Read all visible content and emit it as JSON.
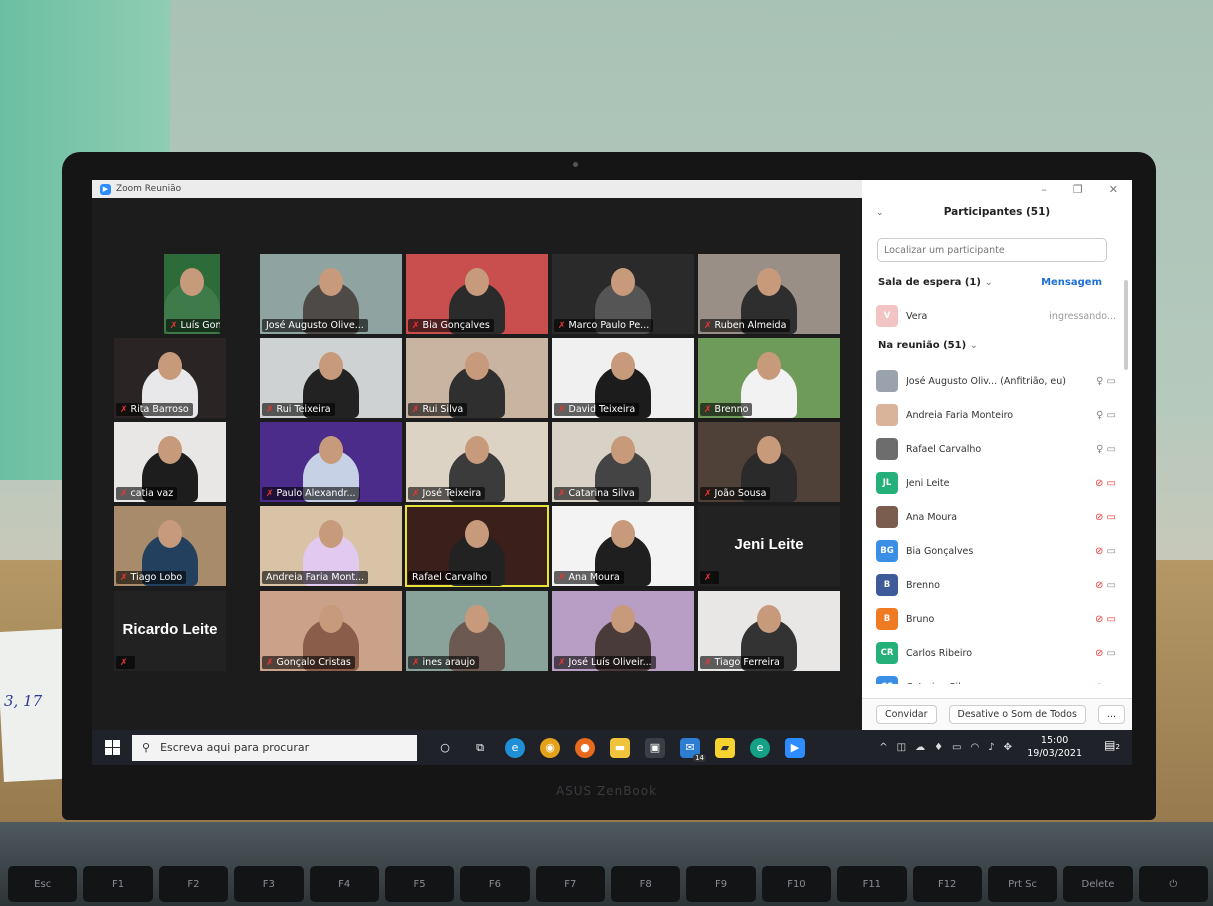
{
  "window": {
    "title": "Zoom Reunião",
    "controls": [
      "–",
      "❐",
      "✕"
    ]
  },
  "gallery": {
    "tiles": [
      {
        "name": "Luís Gonçalves",
        "muted": true
      },
      {
        "name": "José Augusto Olive...",
        "muted": false
      },
      {
        "name": "Bia Gonçalves",
        "muted": true
      },
      {
        "name": "Marco Paulo Pe...",
        "muted": true
      },
      {
        "name": "Ruben Almeida",
        "muted": true
      },
      {
        "name": "Rita Barroso",
        "muted": true
      },
      {
        "name": "Rui Teixeira",
        "muted": true
      },
      {
        "name": "Rui Silva",
        "muted": true
      },
      {
        "name": "David Teixeira",
        "muted": true
      },
      {
        "name": "Brenno",
        "muted": true
      },
      {
        "name": "catia vaz",
        "muted": true
      },
      {
        "name": "Paulo Alexandr...",
        "muted": true
      },
      {
        "name": "José Teixeira",
        "muted": true
      },
      {
        "name": "Catarina Silva",
        "muted": true
      },
      {
        "name": "João Sousa",
        "muted": true
      },
      {
        "name": "Tiago Lobo",
        "muted": true
      },
      {
        "name": "Andreia Faria Mont...",
        "muted": false
      },
      {
        "name": "Rafael Carvalho",
        "muted": false
      },
      {
        "name": "Ana Moura",
        "muted": true
      },
      {
        "name": "",
        "muted": true,
        "big_name": "Jeni Leite"
      },
      {
        "name": "",
        "muted": true,
        "big_name": "Ricardo Leite"
      },
      {
        "name": "Gonçalo Cristas",
        "muted": true
      },
      {
        "name": "ines araujo",
        "muted": true
      },
      {
        "name": "José Luís Oliveir...",
        "muted": true
      },
      {
        "name": "Tiago Ferreira",
        "muted": true
      }
    ]
  },
  "participants": {
    "title": "Participantes (51)",
    "search_placeholder": "Localizar um participante",
    "waiting_room_label": "Sala de espera (1)",
    "message_button": "Mensagem",
    "waiting": {
      "name": "Vera",
      "initial": "V",
      "status": "ingressando..."
    },
    "in_meeting_label": "Na reunião (51)",
    "list": [
      {
        "name": "José Augusto Oliv... (Anfitrião, eu)",
        "initials": "",
        "color": "#9aa3ad",
        "mic": "on",
        "video": "off"
      },
      {
        "name": "Andreia Faria Monteiro",
        "initials": "",
        "color": "#d9b39a",
        "mic": "on",
        "video": "off"
      },
      {
        "name": "Rafael Carvalho",
        "initials": "",
        "color": "#6d6d6d",
        "mic": "on",
        "video": "off"
      },
      {
        "name": "Jeni Leite",
        "initials": "JL",
        "color": "#25b07a",
        "mic": "muted",
        "video": "stopped"
      },
      {
        "name": "Ana Moura",
        "initials": "",
        "color": "#7a5d4f",
        "mic": "muted",
        "video": "stopped"
      },
      {
        "name": "Bia Gonçalves",
        "initials": "BG",
        "color": "#3a8ee6",
        "mic": "muted",
        "video": "off"
      },
      {
        "name": "Brenno",
        "initials": "B",
        "color": "#3d5a99",
        "mic": "muted",
        "video": "off"
      },
      {
        "name": "Bruno",
        "initials": "B",
        "color": "#f07a22",
        "mic": "muted",
        "video": "stopped"
      },
      {
        "name": "Carlos Ribeiro",
        "initials": "CR",
        "color": "#25b07a",
        "mic": "muted",
        "video": "off"
      },
      {
        "name": "Catarina Silva",
        "initials": "CS",
        "color": "#3a8ee6",
        "mic": "muted",
        "video": "off"
      }
    ],
    "invite_button": "Convidar",
    "mute_all_button": "Desative o Som de Todos",
    "more_button": "..."
  },
  "taskbar": {
    "search_placeholder": "Escreva aqui para procurar",
    "mail_badge": "14",
    "time": "15:00",
    "date": "19/03/2021",
    "notifications": "2"
  },
  "laptop_brand": "ASUS ZenBook",
  "keys": [
    "Esc",
    "F1",
    "F2",
    "F3",
    "F4",
    "F5",
    "F6",
    "F7",
    "F8",
    "F9",
    "F10",
    "F11",
    "F12",
    "Prt Sc",
    "Delete",
    "⏻"
  ],
  "desk_note": "3,  17"
}
